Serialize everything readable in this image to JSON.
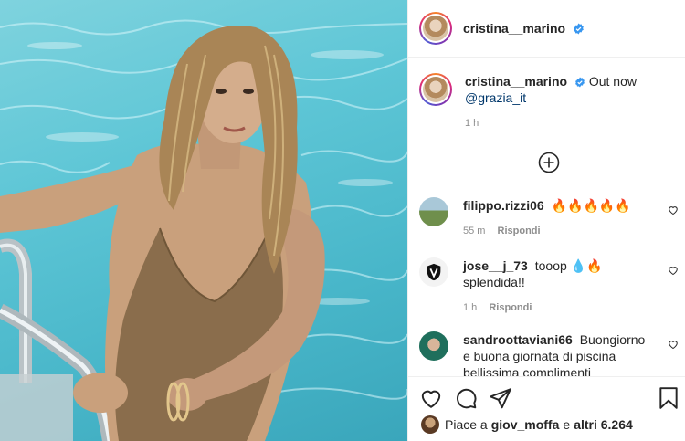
{
  "post": {
    "author": "cristina__marino",
    "verified": true,
    "caption": {
      "text": "Out now",
      "mention": "@grazia_it",
      "time": "1 h"
    }
  },
  "comments": [
    {
      "username": "filippo.rizzi06",
      "text": "🔥🔥🔥🔥🔥",
      "time": "55 m",
      "reply_label": "Rispondi"
    },
    {
      "username": "jose__j_73",
      "text": "tooop 💧🔥 splendida!!",
      "time": "1 h",
      "reply_label": "Rispondi"
    },
    {
      "username": "sandroottaviani66",
      "text": "Buongiorno e buona giornata di piscina bellissima complimenti",
      "time": "",
      "reply_label": ""
    }
  ],
  "likes": {
    "prefix": "Piace a",
    "user": "giov_moffa",
    "connector": "e",
    "others": "altri 6.264"
  },
  "colors": {
    "verified_blue": "#3897f0",
    "mention": "#00376b",
    "meta_gray": "#8e8e8e"
  },
  "icons": [
    "verified-badge-icon",
    "plus-circle-icon",
    "heart-icon",
    "comment-icon",
    "share-icon",
    "bookmark-icon"
  ]
}
